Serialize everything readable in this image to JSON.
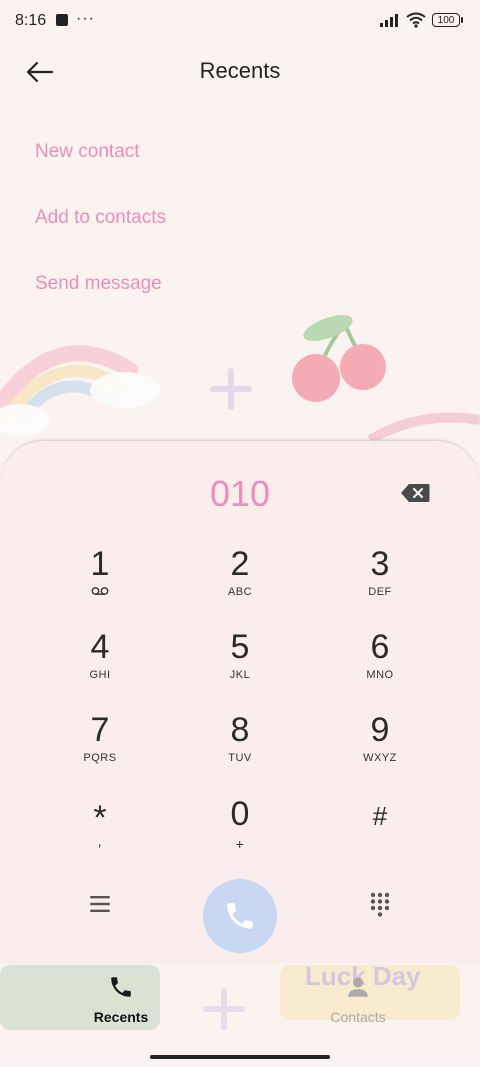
{
  "status_bar": {
    "time": "8:16",
    "dots": "···",
    "battery": "100"
  },
  "header": {
    "title": "Recents"
  },
  "menu": {
    "new_contact": "New contact",
    "add_to_contacts": "Add to contacts",
    "send_message": "Send message"
  },
  "dialer": {
    "number": "010",
    "keys": [
      {
        "digit": "1",
        "letters": ""
      },
      {
        "digit": "2",
        "letters": "ABC"
      },
      {
        "digit": "3",
        "letters": "DEF"
      },
      {
        "digit": "4",
        "letters": "GHI"
      },
      {
        "digit": "5",
        "letters": "JKL"
      },
      {
        "digit": "6",
        "letters": "MNO"
      },
      {
        "digit": "7",
        "letters": "PQRS"
      },
      {
        "digit": "8",
        "letters": "TUV"
      },
      {
        "digit": "9",
        "letters": "WXYZ"
      },
      {
        "digit": "*",
        "letters": ","
      },
      {
        "digit": "0",
        "letters": "+"
      },
      {
        "digit": "#",
        "letters": ""
      }
    ]
  },
  "tabs": {
    "recents": "Recents",
    "contacts": "Contacts"
  },
  "wallpaper": {
    "sign_text": "Luck Day"
  },
  "colors": {
    "accent_pink": "#f08cbc",
    "call_button": "#c8d8f2",
    "background": "#faf3ef"
  }
}
